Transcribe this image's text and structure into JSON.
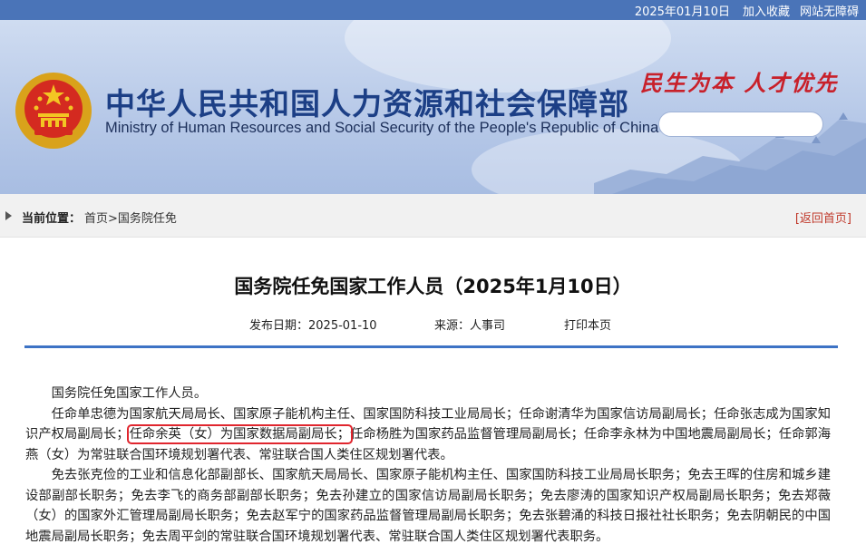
{
  "topbar": {
    "date": "2025年01月10日",
    "favorite_link": "加入收藏",
    "accessibility_link": "网站无障碍"
  },
  "header": {
    "title_cn": "中华人民共和国人力资源和社会保障部",
    "title_en": "Ministry of Human Resources and Social Security of the People's Republic of China",
    "slogan": "民生为本 人才优先",
    "search_placeholder": ""
  },
  "breadcrumb": {
    "label": "当前位置：",
    "home": "首页",
    "separator": ">",
    "current": "国务院任免",
    "back_link": "[返回首页]"
  },
  "article": {
    "title": "国务院任免国家工作人员（2025年1月10日）",
    "publish_date": "发布日期：2025-01-10",
    "source": "来源：人事司",
    "print": "打印本页",
    "intro": "国务院任免国家工作人员。",
    "p1_before": "任命单忠德为国家航天局局长、国家原子能机构主任、国家国防科技工业局局长；任命谢清华为国家信访局副局长；任命张志成为国家知识产权局副局长；",
    "p1_highlight": "任命余英（女）为国家数据局副局长；",
    "p1_after": "任命杨胜为国家药品监督管理局副局长；任命李永林为中国地震局副局长；任命郭海燕（女）为常驻联合国环境规划署代表、常驻联合国人类住区规划署代表。",
    "p2": "免去张克俭的工业和信息化部副部长、国家航天局局长、国家原子能机构主任、国家国防科技工业局局长职务；免去王晖的住房和城乡建设部副部长职务；免去李飞的商务部副部长职务；免去孙建立的国家信访局副局长职务；免去廖涛的国家知识产权局副局长职务；免去郑薇（女）的国家外汇管理局副局长职务；免去赵军宁的国家药品监督管理局副局长职务；免去张碧涌的科技日报社社长职务；免去阴朝民的中国地震局副局长职务；免去周平剑的常驻联合国环境规划署代表、常驻联合国人类住区规划署代表职务。"
  },
  "colors": {
    "topbar": "#4a74b8",
    "title_blue": "#1c3f86",
    "slogan_red": "#c8202a",
    "rule_blue": "#3d73c5",
    "highlight_red": "#e0262e"
  }
}
